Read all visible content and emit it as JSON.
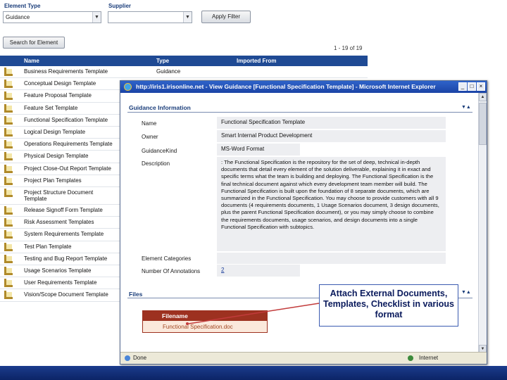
{
  "filter": {
    "element_type_label": "Element Type",
    "element_type_value": "Guidance",
    "supplier_label": "Supplier",
    "supplier_value": "",
    "apply_filter_label": "Apply Filter",
    "search_label": "Search for Element"
  },
  "list": {
    "count_text": "1 - 19 of 19",
    "columns": [
      "Name",
      "Type",
      "Imported From"
    ],
    "rows": [
      {
        "name": "Business Requirements Template",
        "type": "Guidance"
      },
      {
        "name": "Conceptual Design Template",
        "type": ""
      },
      {
        "name": "Feature Proposal Template",
        "type": ""
      },
      {
        "name": "Feature Set Template",
        "type": ""
      },
      {
        "name": "Functional Specification Template",
        "type": ""
      },
      {
        "name": "Logical Design Template",
        "type": ""
      },
      {
        "name": "Operations Requirements Template",
        "type": ""
      },
      {
        "name": "Physical Design Template",
        "type": ""
      },
      {
        "name": "Project Close-Out Report Template",
        "type": ""
      },
      {
        "name": "Project Plan Templates",
        "type": ""
      },
      {
        "name": "Project Structure Document Template",
        "type": ""
      },
      {
        "name": "Release Signoff Form Template",
        "type": ""
      },
      {
        "name": "Risk Assessment Templates",
        "type": ""
      },
      {
        "name": "System Requirements Template",
        "type": ""
      },
      {
        "name": "Test Plan Template",
        "type": ""
      },
      {
        "name": "Testing and Bug Report Template",
        "type": ""
      },
      {
        "name": "Usage Scenarios Template",
        "type": ""
      },
      {
        "name": "User Requirements Template",
        "type": ""
      },
      {
        "name": "Vision/Scope Document Template",
        "type": ""
      }
    ]
  },
  "popup": {
    "title": "http://iris1.irisonline.net - View Guidance [Functional Specification Template] - Microsoft Internet Explorer",
    "section_guidance": "Guidance Information",
    "fields": {
      "name_label": "Name",
      "name_value": "Functional Specification Template",
      "owner_label": "Owner",
      "owner_value": "Smart Internal Product Development",
      "kind_label": "GuidanceKind",
      "kind_value": "MS-Word Format",
      "desc_label": "Description",
      "desc_value": ": The Functional Specification is the repository for the set of deep, technical in-depth documents that detail every element of the solution deliverable, explaining it in exact and specific terms what the team is building and deploying. The Functional Specification is the final technical document against which every development team member will build. The Functional Specification is built upon the foundation of 8 separate documents, which are summarized in the Functional Specification. You may choose to provide customers with all 9 documents (4 requirements documents, 1 Usage Scenarios document, 3 design documents, plus the parent Functional Specification document), or you may simply choose to combine the requirements documents, usage scenarios, and design documents into a single Functional Specification with subtopics.",
      "categories_label": "Element Categories",
      "categories_value": "",
      "annotations_label": "Number Of Annotations",
      "annotations_value": "2"
    },
    "section_files": "Files",
    "files_header": "Filename",
    "file_name": "Functional Specification.doc",
    "status_left": "Done",
    "status_right": "Internet"
  },
  "callout_text": "Attach External Documents, Templates, Checklist in various format"
}
